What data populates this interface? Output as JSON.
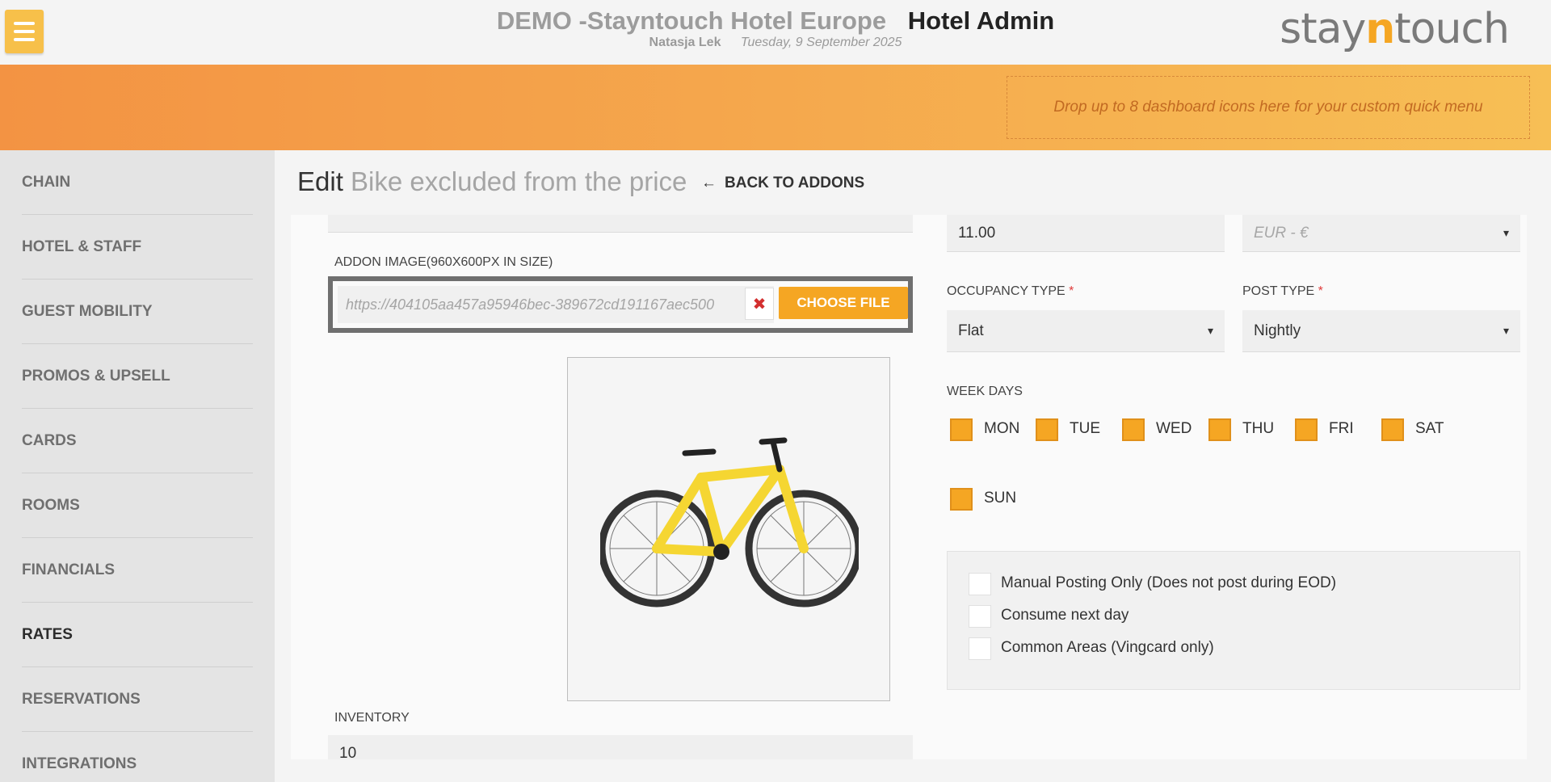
{
  "header": {
    "hotel_name": "DEMO -Stayntouch Hotel Europe",
    "app_name": "Hotel Admin",
    "user": "Natasja Lek",
    "date": "Tuesday, 9 September 2025",
    "logo_part1": "stay",
    "logo_part2": "n",
    "logo_part3": "touch"
  },
  "banner": {
    "dropzone_text": "Drop up to 8 dashboard icons here for your custom quick menu"
  },
  "sidebar": {
    "items": [
      {
        "label": "CHAIN"
      },
      {
        "label": "HOTEL & STAFF"
      },
      {
        "label": "GUEST MOBILITY"
      },
      {
        "label": "PROMOS & UPSELL"
      },
      {
        "label": "CARDS"
      },
      {
        "label": "ROOMS"
      },
      {
        "label": "FINANCIALS"
      },
      {
        "label": "RATES"
      },
      {
        "label": "RESERVATIONS"
      },
      {
        "label": "INTEGRATIONS"
      }
    ],
    "active": "RATES"
  },
  "page": {
    "edit_word": "Edit",
    "addon_name": "Bike excluded from the price",
    "back_label": "BACK TO ADDONS"
  },
  "form": {
    "addon_image_label": "ADDON IMAGE(960X600PX IN SIZE)",
    "image_url": "https://404105aa457a95946bec-389672cd191167aec500",
    "choose_file_label": "CHOOSE FILE",
    "clear_symbol": "✖",
    "inventory_label": "INVENTORY",
    "inventory_value": "10",
    "amount_value": "11.00",
    "currency_value": "EUR - €",
    "occupancy_label": "OCCUPANCY TYPE",
    "occupancy_value": "Flat",
    "post_type_label": "POST TYPE",
    "post_type_value": "Nightly",
    "required_mark": "*",
    "week_days_label": "WEEK DAYS",
    "week_days": [
      "MON",
      "TUE",
      "WED",
      "THU",
      "FRI",
      "SAT",
      "SUN"
    ],
    "options": [
      "Manual Posting Only (Does not post during EOD)",
      "Consume next day",
      "Common Areas (Vingcard only)"
    ]
  },
  "colors": {
    "accent": "#f5a623",
    "banner_start": "#f39343",
    "banner_end": "#f7bf55"
  }
}
